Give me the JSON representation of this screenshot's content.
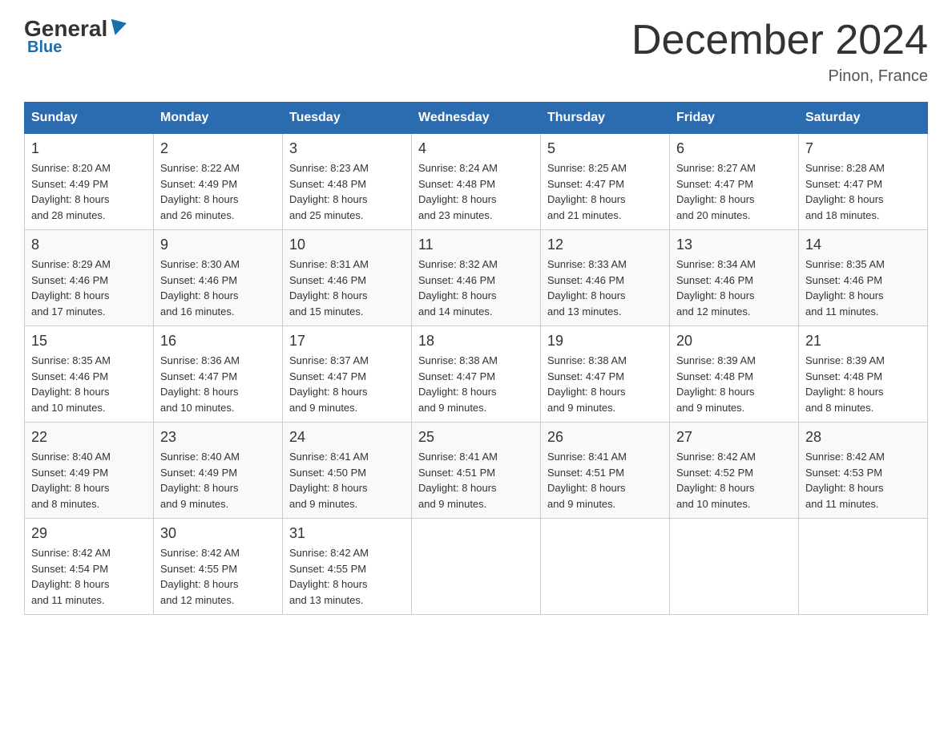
{
  "header": {
    "logo_general": "General",
    "logo_blue": "Blue",
    "title": "December 2024",
    "location": "Pinon, France"
  },
  "days_of_week": [
    "Sunday",
    "Monday",
    "Tuesday",
    "Wednesday",
    "Thursday",
    "Friday",
    "Saturday"
  ],
  "weeks": [
    [
      {
        "day": "1",
        "sunrise": "8:20 AM",
        "sunset": "4:49 PM",
        "daylight": "8 hours and 28 minutes."
      },
      {
        "day": "2",
        "sunrise": "8:22 AM",
        "sunset": "4:49 PM",
        "daylight": "8 hours and 26 minutes."
      },
      {
        "day": "3",
        "sunrise": "8:23 AM",
        "sunset": "4:48 PM",
        "daylight": "8 hours and 25 minutes."
      },
      {
        "day": "4",
        "sunrise": "8:24 AM",
        "sunset": "4:48 PM",
        "daylight": "8 hours and 23 minutes."
      },
      {
        "day": "5",
        "sunrise": "8:25 AM",
        "sunset": "4:47 PM",
        "daylight": "8 hours and 21 minutes."
      },
      {
        "day": "6",
        "sunrise": "8:27 AM",
        "sunset": "4:47 PM",
        "daylight": "8 hours and 20 minutes."
      },
      {
        "day": "7",
        "sunrise": "8:28 AM",
        "sunset": "4:47 PM",
        "daylight": "8 hours and 18 minutes."
      }
    ],
    [
      {
        "day": "8",
        "sunrise": "8:29 AM",
        "sunset": "4:46 PM",
        "daylight": "8 hours and 17 minutes."
      },
      {
        "day": "9",
        "sunrise": "8:30 AM",
        "sunset": "4:46 PM",
        "daylight": "8 hours and 16 minutes."
      },
      {
        "day": "10",
        "sunrise": "8:31 AM",
        "sunset": "4:46 PM",
        "daylight": "8 hours and 15 minutes."
      },
      {
        "day": "11",
        "sunrise": "8:32 AM",
        "sunset": "4:46 PM",
        "daylight": "8 hours and 14 minutes."
      },
      {
        "day": "12",
        "sunrise": "8:33 AM",
        "sunset": "4:46 PM",
        "daylight": "8 hours and 13 minutes."
      },
      {
        "day": "13",
        "sunrise": "8:34 AM",
        "sunset": "4:46 PM",
        "daylight": "8 hours and 12 minutes."
      },
      {
        "day": "14",
        "sunrise": "8:35 AM",
        "sunset": "4:46 PM",
        "daylight": "8 hours and 11 minutes."
      }
    ],
    [
      {
        "day": "15",
        "sunrise": "8:35 AM",
        "sunset": "4:46 PM",
        "daylight": "8 hours and 10 minutes."
      },
      {
        "day": "16",
        "sunrise": "8:36 AM",
        "sunset": "4:47 PM",
        "daylight": "8 hours and 10 minutes."
      },
      {
        "day": "17",
        "sunrise": "8:37 AM",
        "sunset": "4:47 PM",
        "daylight": "8 hours and 9 minutes."
      },
      {
        "day": "18",
        "sunrise": "8:38 AM",
        "sunset": "4:47 PM",
        "daylight": "8 hours and 9 minutes."
      },
      {
        "day": "19",
        "sunrise": "8:38 AM",
        "sunset": "4:47 PM",
        "daylight": "8 hours and 9 minutes."
      },
      {
        "day": "20",
        "sunrise": "8:39 AM",
        "sunset": "4:48 PM",
        "daylight": "8 hours and 9 minutes."
      },
      {
        "day": "21",
        "sunrise": "8:39 AM",
        "sunset": "4:48 PM",
        "daylight": "8 hours and 8 minutes."
      }
    ],
    [
      {
        "day": "22",
        "sunrise": "8:40 AM",
        "sunset": "4:49 PM",
        "daylight": "8 hours and 8 minutes."
      },
      {
        "day": "23",
        "sunrise": "8:40 AM",
        "sunset": "4:49 PM",
        "daylight": "8 hours and 9 minutes."
      },
      {
        "day": "24",
        "sunrise": "8:41 AM",
        "sunset": "4:50 PM",
        "daylight": "8 hours and 9 minutes."
      },
      {
        "day": "25",
        "sunrise": "8:41 AM",
        "sunset": "4:51 PM",
        "daylight": "8 hours and 9 minutes."
      },
      {
        "day": "26",
        "sunrise": "8:41 AM",
        "sunset": "4:51 PM",
        "daylight": "8 hours and 9 minutes."
      },
      {
        "day": "27",
        "sunrise": "8:42 AM",
        "sunset": "4:52 PM",
        "daylight": "8 hours and 10 minutes."
      },
      {
        "day": "28",
        "sunrise": "8:42 AM",
        "sunset": "4:53 PM",
        "daylight": "8 hours and 11 minutes."
      }
    ],
    [
      {
        "day": "29",
        "sunrise": "8:42 AM",
        "sunset": "4:54 PM",
        "daylight": "8 hours and 11 minutes."
      },
      {
        "day": "30",
        "sunrise": "8:42 AM",
        "sunset": "4:55 PM",
        "daylight": "8 hours and 12 minutes."
      },
      {
        "day": "31",
        "sunrise": "8:42 AM",
        "sunset": "4:55 PM",
        "daylight": "8 hours and 13 minutes."
      },
      null,
      null,
      null,
      null
    ]
  ],
  "labels": {
    "sunrise": "Sunrise:",
    "sunset": "Sunset:",
    "daylight": "Daylight:"
  }
}
